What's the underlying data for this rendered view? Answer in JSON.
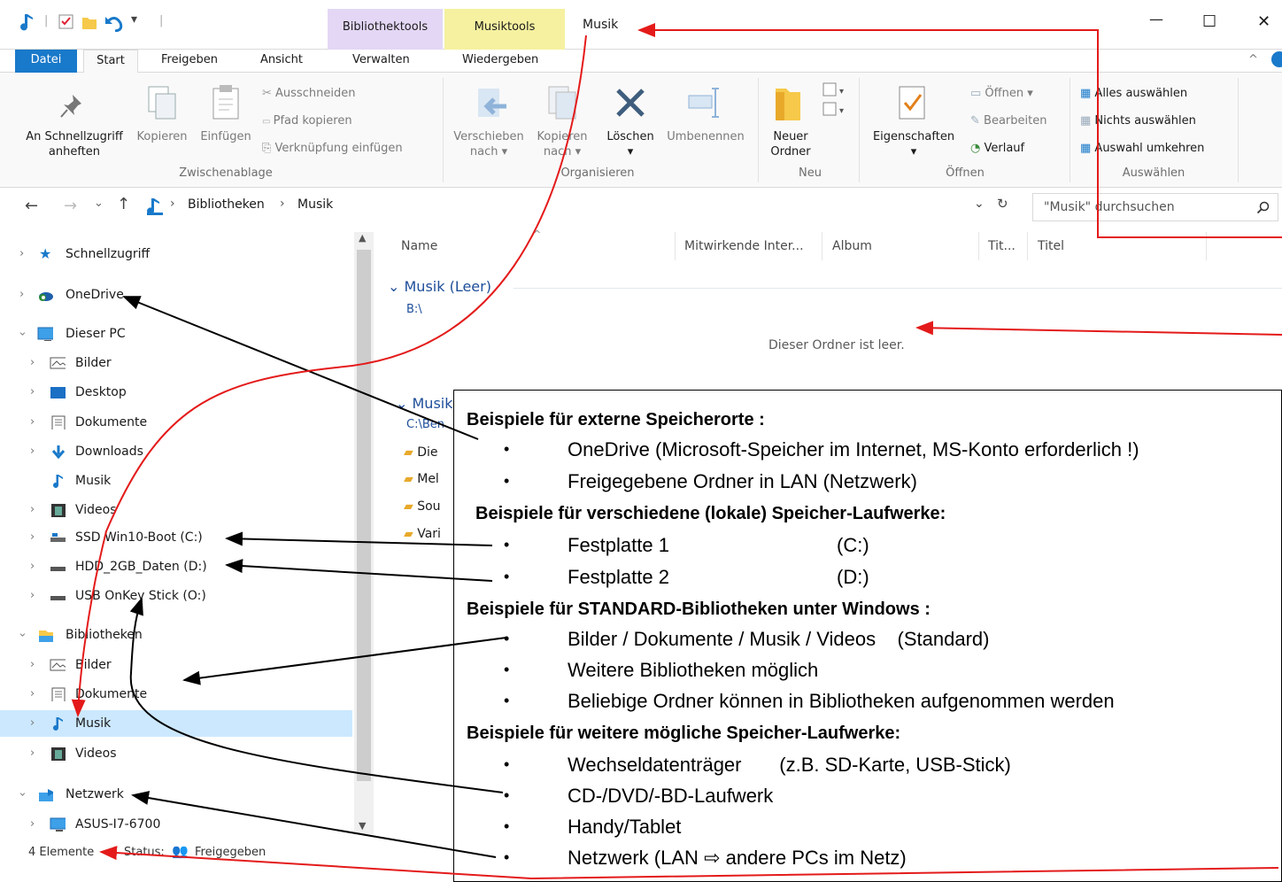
{
  "window": {
    "title": "Musik",
    "context_tabs": [
      "Bibliothektools",
      "Musiktools"
    ],
    "controls": {
      "minimize": "—",
      "maximize": "☐",
      "close": "✕"
    },
    "colors": {
      "accent": "#1979ca",
      "bibliothek_tab": "#e3d7f5",
      "musik_tab": "#f5f1a0",
      "annotation_red": "#e41a1a"
    }
  },
  "ribbon_tabs": [
    "Datei",
    "Start",
    "Freigeben",
    "Ansicht",
    "Verwalten",
    "Wiedergeben"
  ],
  "ribbon": {
    "zwischenablage": {
      "pin_label_1": "An Schnellzugriff",
      "pin_label_2": "anheften",
      "copy": "Kopieren",
      "paste": "Einfügen",
      "cut": "Ausschneiden",
      "copy_path": "Pfad kopieren",
      "paste_shortcut": "Verknüpfung einfügen",
      "group": "Zwischenablage"
    },
    "organisieren": {
      "move_1": "Verschieben",
      "move_2": "nach ▾",
      "copy_1": "Kopieren",
      "copy_2": "nach ▾",
      "delete": "Löschen",
      "delete_arrow": "▾",
      "rename": "Umbenennen",
      "group": "Organisieren"
    },
    "neu": {
      "folder_1": "Neuer",
      "folder_2": "Ordner",
      "group": "Neu"
    },
    "oeffnen": {
      "properties": "Eigenschaften",
      "properties_arrow": "▾",
      "open": "Öffnen ▾",
      "edit": "Bearbeiten",
      "history": "Verlauf",
      "group": "Öffnen"
    },
    "auswaehlen": {
      "all": "Alles auswählen",
      "none": "Nichts auswählen",
      "invert": "Auswahl umkehren",
      "group": "Auswählen"
    }
  },
  "address": {
    "back": "←",
    "forward": "→",
    "recent": "⌄",
    "up": "↑",
    "sep1": "›",
    "crumb1": "Bibliotheken",
    "sep2": "›",
    "crumb2": "Musik",
    "dropdown": "⌄",
    "refresh": "↻",
    "search_placeholder": "\"Musik\" durchsuchen"
  },
  "nav": {
    "quick_access": "Schnellzugriff",
    "onedrive": "OneDrive",
    "this_pc": "Dieser PC",
    "pc_bilder": "Bilder",
    "pc_desktop": "Desktop",
    "pc_dokumente": "Dokumente",
    "pc_downloads": "Downloads",
    "pc_musik": "Musik",
    "pc_videos": "Videos",
    "drive_c": "SSD Win10-Boot (C:)",
    "drive_d": "HDD_2GB_Daten (D:)",
    "drive_o": "USB OnKey Stick (O:)",
    "libraries": "Bibliotheken",
    "lib_bilder": "Bilder",
    "lib_dokumente": "Dokumente",
    "lib_musik": "Musik",
    "lib_videos": "Videos",
    "network": "Netzwerk",
    "net_pc": "ASUS-I7-6700"
  },
  "status": {
    "count": "4 Elemente",
    "status_label": "Status:",
    "shared": "Freigegeben"
  },
  "content": {
    "columns": [
      "Name",
      "Mitwirkende Inter...",
      "Album",
      "Tit...",
      "Titel"
    ],
    "group1_title": "Musik (Leer)",
    "group1_path": "B:\\",
    "empty_text": "Dieser Ordner ist leer.",
    "group2_title": "Musik",
    "group2_path": "C:\\Ben",
    "files": [
      "Die",
      "Mel",
      "Sou",
      "Vari"
    ]
  },
  "annotation": {
    "h1": "Beispiele für externe Speicherorte :",
    "h1_items": [
      "OneDrive (Microsoft-Speicher im Internet, MS-Konto erforderlich !)",
      "Freigegebene Ordner in LAN (Netzwerk)"
    ],
    "h2": "Beispiele für verschiedene (lokale) Speicher-Laufwerke:",
    "h2_items": [
      "Festplatte 1",
      "Festplatte 2"
    ],
    "h2_letters": [
      "(C:)",
      "(D:)"
    ],
    "h3": "Beispiele für STANDARD-Bibliotheken unter Windows :",
    "h3_items": [
      "Bilder / Dokumente / Musik / Videos    (Standard)",
      "Weitere Bibliotheken möglich",
      "Beliebige Ordner können in Bibliotheken aufgenommen werden"
    ],
    "h4": "Beispiele für weitere mögliche Speicher-Laufwerke:",
    "h4_items": [
      "Wechseldatenträger       (z.B. SD-Karte, USB-Stick)",
      "CD-/DVD/-BD-Laufwerk",
      "Handy/Tablet",
      "Netzwerk (LAN ⇨ andere PCs im Netz)"
    ],
    "bullet": "•"
  }
}
